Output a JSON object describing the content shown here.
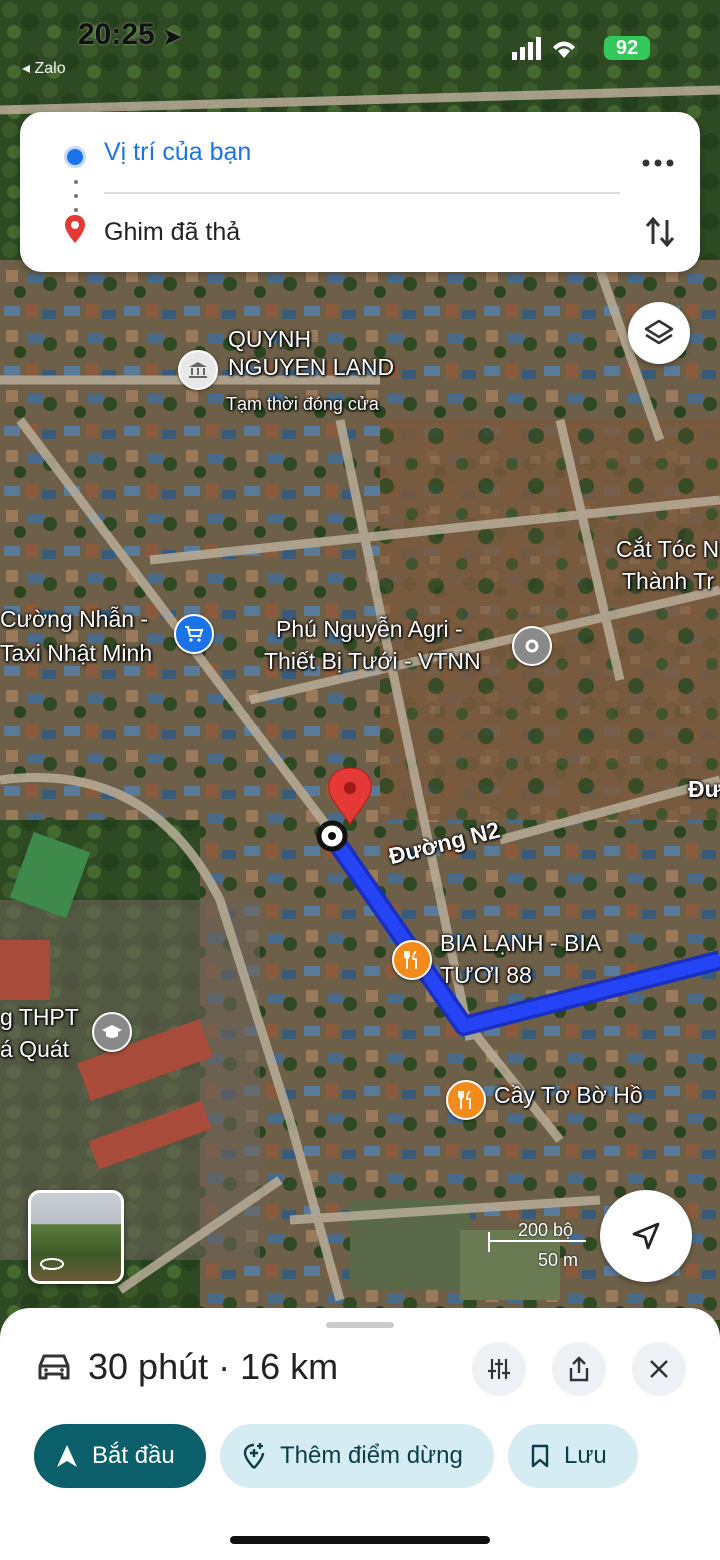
{
  "status_bar": {
    "time": "20:25",
    "back_app": "◂ Zalo",
    "battery": "92"
  },
  "route": {
    "origin": "Vị trí của bạn",
    "destination": "Ghim đã thả"
  },
  "map_labels": {
    "quynh": "QUYNH\nNGUYEN LAND",
    "quynh_status": "Tạm thời đóng cửa",
    "cat_toc_1": "Cắt Tóc N",
    "cat_toc_2": "Thành Tr",
    "cuong_1": "Cường Nhẫn -",
    "cuong_2": "Taxi Nhật Minh",
    "phu_1": "Phú Nguyễn Agri -",
    "phu_2": "Thiết Bị Tưới - VTNN",
    "duong_n2": "Đường N2",
    "du": "Đư",
    "bia_1": "BIA LẠNH - BIA",
    "bia_2": "TƯƠI 88",
    "thpt_1": "g THPT",
    "thpt_2": "á Quát",
    "cay": "Cầy Tơ Bờ Hồ"
  },
  "scale": {
    "imperial": "200 bộ",
    "metric": "50 m"
  },
  "sheet": {
    "eta": "30 phút · 16 km",
    "start_label": "Bắt đầu",
    "add_stop_label": "Thêm điểm dừng",
    "save_label": "Lưu"
  },
  "colors": {
    "route": "#1a3cf0",
    "start_button": "#0b5f6b",
    "secondary_button": "#d5ecf3",
    "origin_blue": "#1a73e8",
    "pin_red": "#e53935"
  },
  "icons": [
    "car-icon",
    "filter-icon",
    "share-icon",
    "close-icon",
    "navigation-arrow-icon",
    "add-location-icon",
    "bookmark-icon",
    "layers-icon",
    "locate-icon",
    "more-icon",
    "swap-icon"
  ]
}
